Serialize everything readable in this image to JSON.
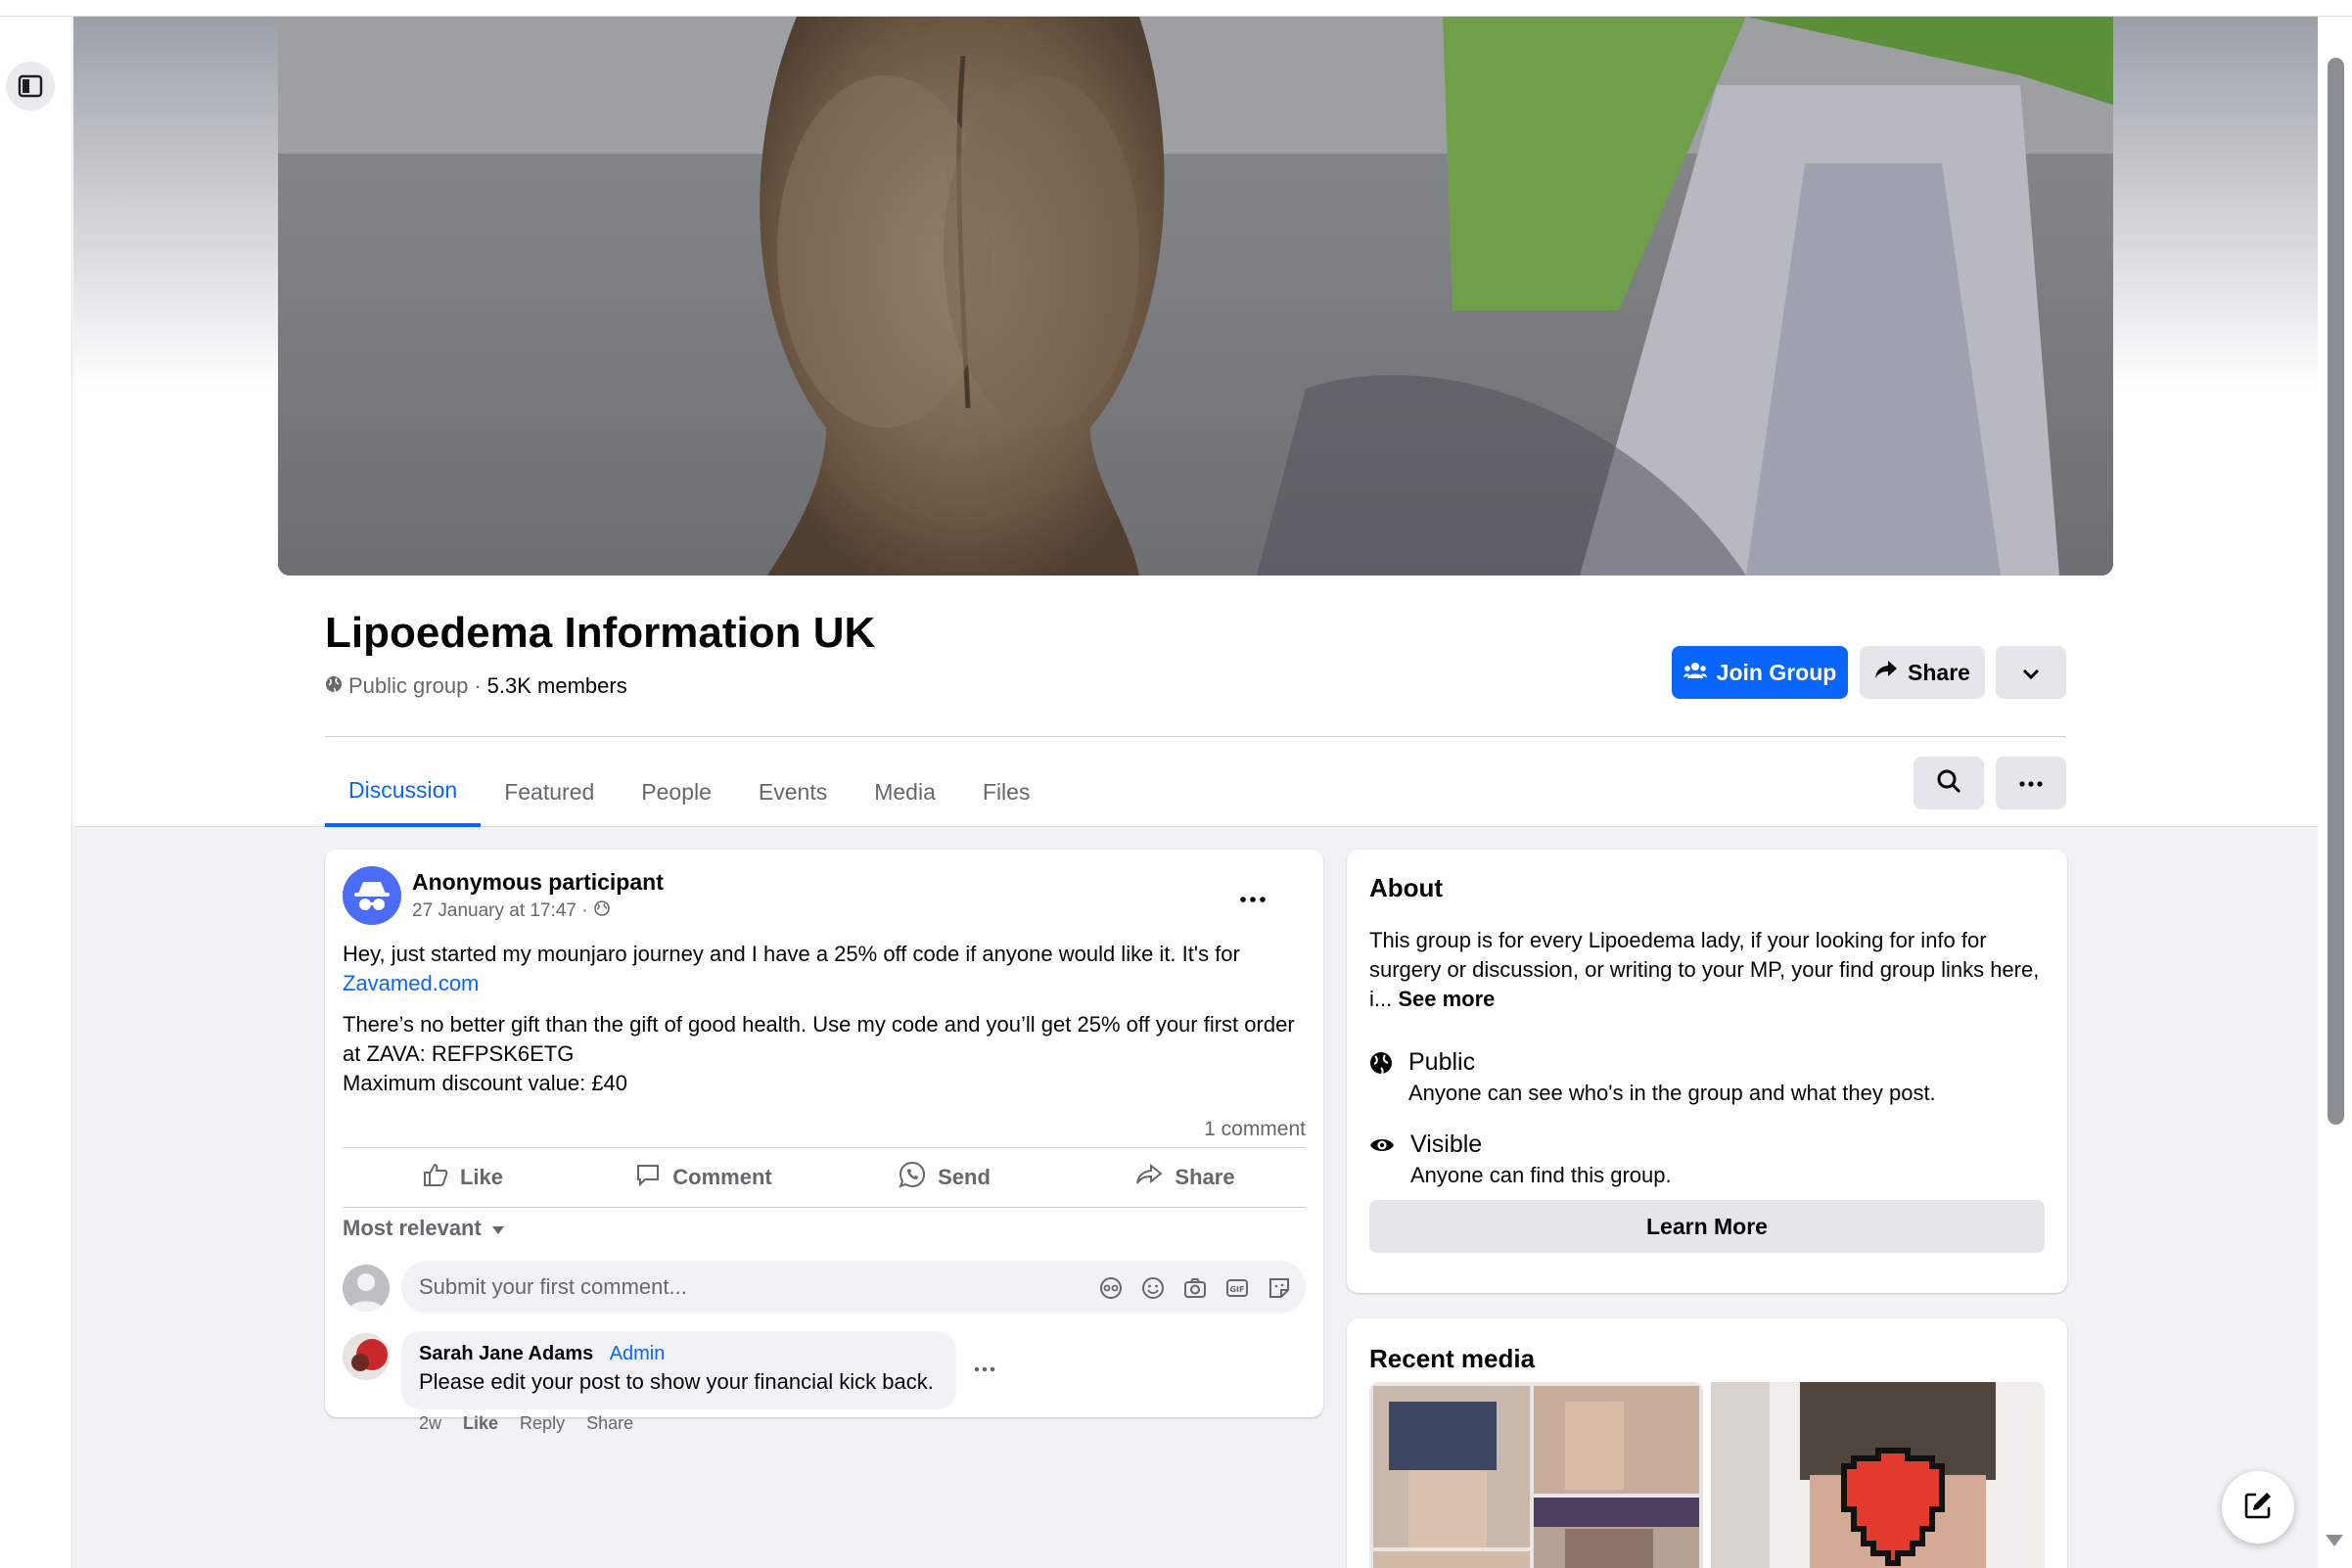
{
  "group": {
    "name": "Lipoedema Information UK",
    "privacy": "Public group",
    "separator": " · ",
    "members": "5.3K members"
  },
  "header_buttons": {
    "join": "Join Group",
    "share": "Share"
  },
  "tabs": [
    {
      "label": "Discussion",
      "active": true
    },
    {
      "label": "Featured"
    },
    {
      "label": "People"
    },
    {
      "label": "Events"
    },
    {
      "label": "Media"
    },
    {
      "label": "Files"
    }
  ],
  "post": {
    "author": "Anonymous participant",
    "time": "27 January at 17:47 ·",
    "body_line1": "Hey, just started my mounjaro journey and I have a 25% off code if anyone would like it. It's for",
    "link": "Zavamed.com",
    "body_line2": "There’s no better gift than the gift of good health. Use my code and you’ll get 25% off your first order at ZAVA: REFPSK6ETG",
    "body_line3": "Maximum discount value: £40",
    "comment_count": "1 comment",
    "actions": {
      "like": "Like",
      "comment": "Comment",
      "send": "Send",
      "share": "Share"
    },
    "sort_label": "Most relevant",
    "comment_placeholder": "Submit your first comment..."
  },
  "reply": {
    "name": "Sarah Jane Adams",
    "role": "Admin",
    "text": "Please edit your post to show your financial kick back.",
    "age": "2w",
    "like": "Like",
    "reply": "Reply",
    "share": "Share"
  },
  "about": {
    "title": "About",
    "description": "This group is for every Lipoedema lady, if your looking for info for surgery or discussion, or writing to your MP, your find group links here, i...",
    "see_more": "See more",
    "public_title": "Public",
    "public_desc": "Anyone can see who's in the group and what they post.",
    "visible_title": "Visible",
    "visible_desc": "Anyone can find this group.",
    "learn_more": "Learn More"
  },
  "recent_media": {
    "title": "Recent media"
  },
  "colors": {
    "accent": "#0866ff",
    "background": "#f0f2f5",
    "secondary_text": "#65676b"
  }
}
